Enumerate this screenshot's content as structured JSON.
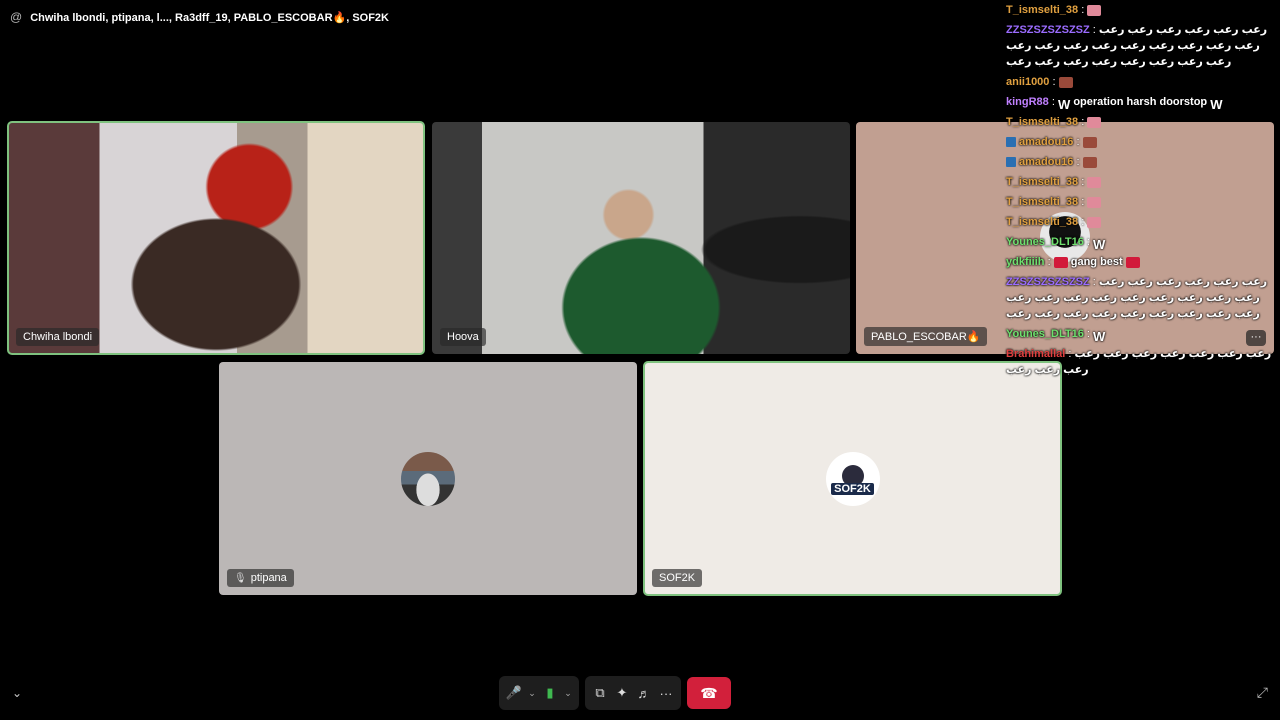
{
  "window": {
    "at_icon": "@",
    "title": "Chwiha lbondi, ptipana, l..., Ra3dff_19, PABLO_ESCOBAR🔥, SOF2K"
  },
  "tiles": [
    {
      "name": "Chwiha lbondi",
      "speaking": true
    },
    {
      "name": "Hoova",
      "speaking": false
    },
    {
      "name": "PABLO_ESCOBAR🔥",
      "speaking": false,
      "more_icon": "···"
    },
    {
      "name": "ptipana",
      "speaking": false,
      "muted": true,
      "muted_icon": "🎙"
    },
    {
      "name": "SOF2K",
      "speaking": true,
      "avatar_text": "SOF2K"
    }
  ],
  "chat": [
    {
      "user": "T_ismselti_38",
      "color": "#e0a040",
      "text": "",
      "emote": "lip"
    },
    {
      "user": "ZZSZSZSZSZSZ",
      "color": "#9b6cff",
      "text": "رعب رعب رعب رعب رعب رعب رعب رعب رعب رعب رعب رعب رعب رعب رعب رعب رعب رعب رعب رعب رعب رعب رعب"
    },
    {
      "user": "anii1000",
      "color": "#e0a040",
      "text": "",
      "emote": "box"
    },
    {
      "user": "kingR88",
      "color": "#c080ff",
      "text": "operation harsh doorstop",
      "emote": "w"
    },
    {
      "user": "T_ismselti_38",
      "color": "#e0a040",
      "text": "",
      "emote": "lip"
    },
    {
      "user": "amadou16",
      "color": "#e0a040",
      "text": "",
      "emote": "box",
      "badge": true
    },
    {
      "user": "amadou16",
      "color": "#e0a040",
      "text": "",
      "emote": "box",
      "badge": true
    },
    {
      "user": "T_ismselti_38",
      "color": "#e0a040",
      "text": "",
      "emote": "lip"
    },
    {
      "user": "T_ismselti_38",
      "color": "#e0a040",
      "text": "",
      "emote": "lip"
    },
    {
      "user": "T_ismselti_38",
      "color": "#e0a040",
      "text": "",
      "emote": "lip"
    },
    {
      "user": "Younes_DLT16",
      "color": "#6ee06e",
      "text": "",
      "emote": "w"
    },
    {
      "user": "ydkfiiih",
      "color": "#6ee06e",
      "text": "gang best",
      "emote": "ember"
    },
    {
      "user": "ZZSZSZSZSZSZ",
      "color": "#9b6cff",
      "text": "رعب رعب رعب رعب رعب رعب رعب رعب رعب رعب رعب رعب رعب رعب رعب رعب رعب رعب رعب رعب رعب رعب رعب رعب"
    },
    {
      "user": "Younes_DLT16",
      "color": "#6ee06e",
      "text": "",
      "emote": "w"
    },
    {
      "user": "Brahimallal",
      "color": "#e04040",
      "text": "رعب رعب رعب رعب رعب رعب رعب رعب رعب رعب"
    }
  ],
  "controls": {
    "mic_icon": "🎤",
    "chevron_icon": "⌄",
    "camera_icon": "▮",
    "share_icon": "⧉",
    "activities_icon": "✦",
    "soundboard_icon": "♬",
    "more_icon": "···",
    "leave_icon": "☎",
    "collapse_icon": "⌄",
    "fullscreen_icon": "⤢"
  }
}
